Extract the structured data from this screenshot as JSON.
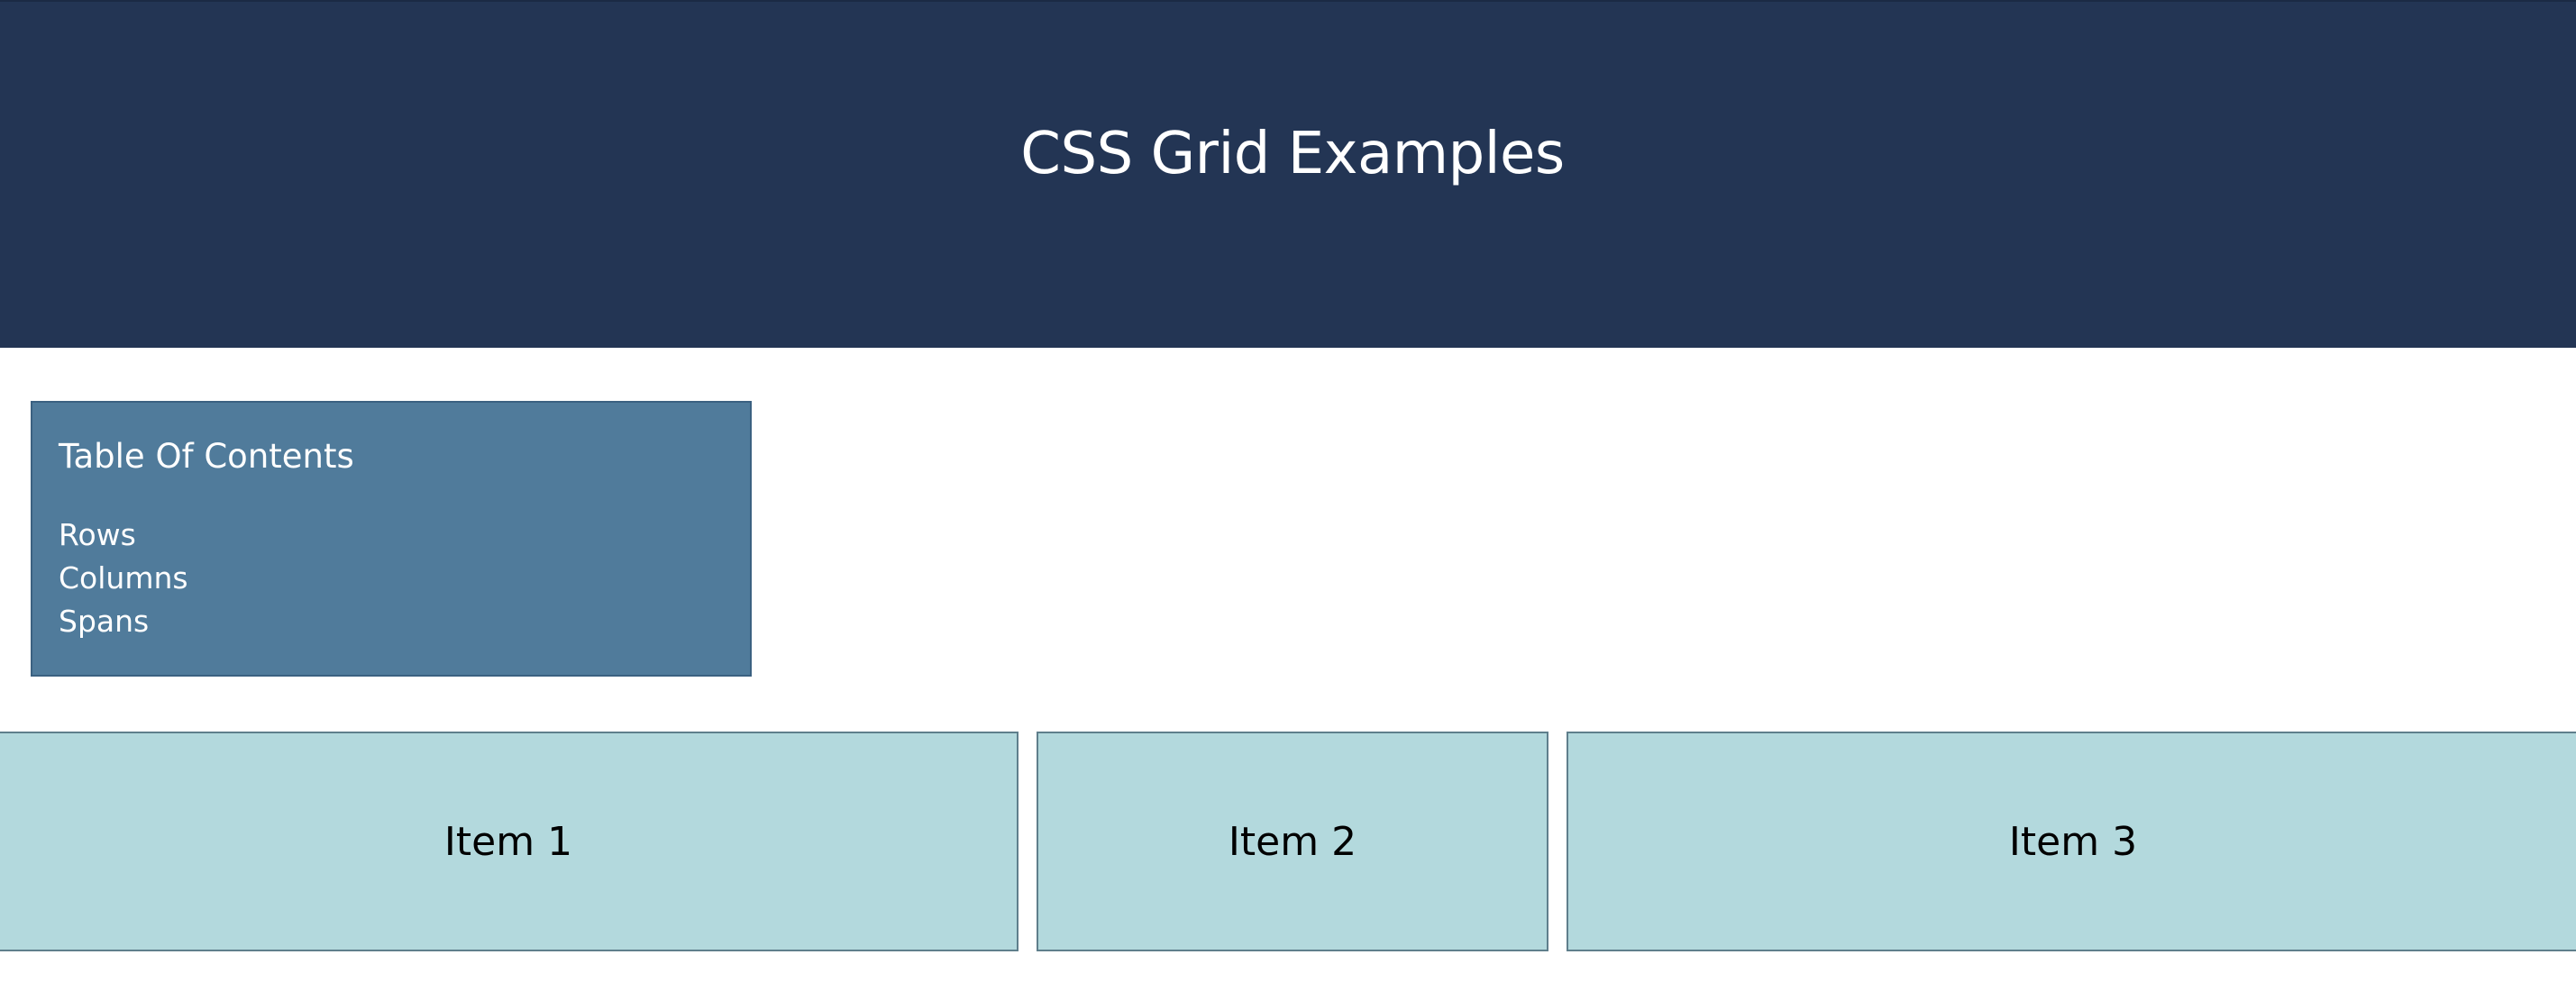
{
  "header": {
    "title": "CSS Grid Examples"
  },
  "toc": {
    "title": "Table Of Contents",
    "links": [
      "Rows",
      "Columns",
      "Spans"
    ]
  },
  "grid": {
    "items": [
      "Item 1",
      "Item 2",
      "Item 3"
    ]
  },
  "colors": {
    "header_bg": "#233554",
    "toc_bg": "#507b9b",
    "item_bg": "#b3d9dd",
    "text_light": "#ffffff",
    "text_dark": "#000000"
  }
}
